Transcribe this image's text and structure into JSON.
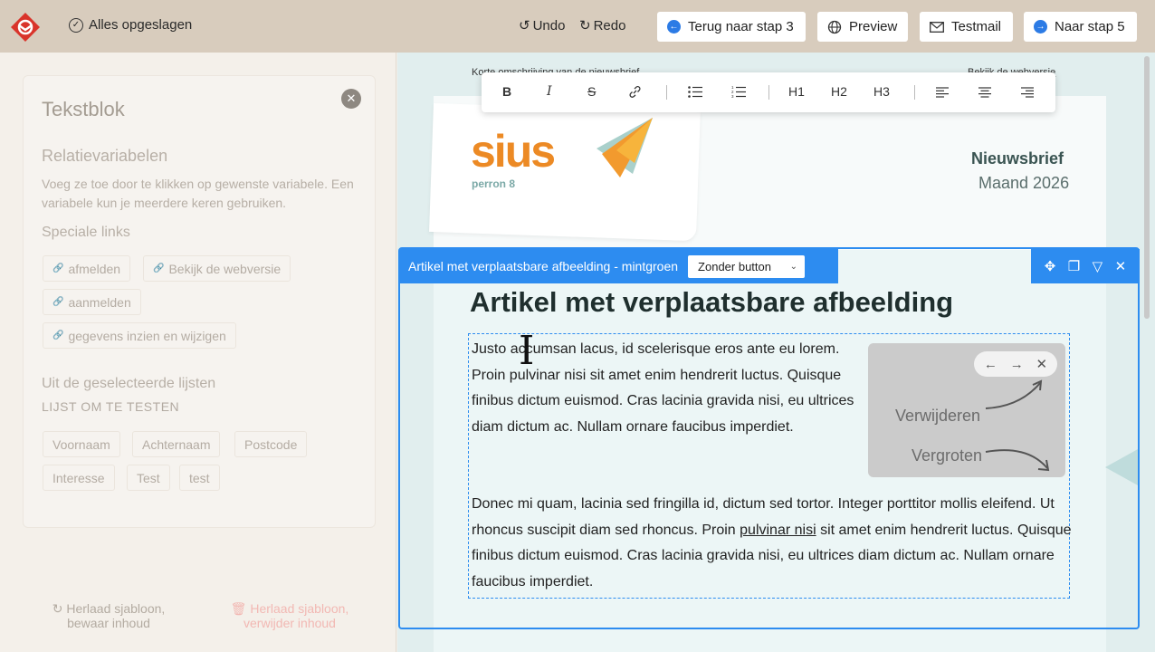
{
  "topbar": {
    "saved_label": "Alles opgeslagen",
    "undo_label": "Undo",
    "redo_label": "Redo",
    "back_label": "Terug naar stap 3",
    "preview_label": "Preview",
    "testmail_label": "Testmail",
    "next_label": "Naar stap 5"
  },
  "panel": {
    "title": "Tekstblok",
    "relation_title": "Relatievariabelen",
    "relation_desc": "Voeg ze toe door te klikken op gewenste variabele. Een variabele kun je meerdere keren gebruiken.",
    "special_title": "Speciale links",
    "special_links": [
      "afmelden",
      "Bekijk de webversie",
      "aanmelden",
      "gegevens inzien en wijzigen"
    ],
    "lists_title": "Uit de geselecteerde lijsten",
    "list_name": "LIJST OM TE TESTEN",
    "fields": [
      "Voornaam",
      "Achternaam",
      "Postcode",
      "Interesse",
      "Test",
      "test"
    ],
    "reload_keep": "Herlaad sjabloon, bewaar inhoud",
    "reload_delete": "Herlaad sjabloon, verwijder inhoud"
  },
  "email": {
    "top_left": "Korte omschrijving van de nieuwsbrief",
    "top_right": "Bekijk de webversie",
    "brand": "sius",
    "brand_sub": "perron 8",
    "newsletter": "Nieuwsbrief",
    "month": "Maand 2026",
    "block_title": "Artikel met verplaatsbare afbeelding - mintgroen",
    "button_select": "Zonder button",
    "article_title": "Artikel met verplaatsbare afbeelding",
    "para1": "Justo accumsan lacus, id scelerisque eros ante eu lorem. Proin pulvinar nisi sit amet enim hendrerit luctus. Quisque finibus dictum euismod. Cras lacinia gravida nisi, eu ultrices diam dictum ac. Nullam ornare faucibus imperdiet.",
    "para2_before": "Donec mi quam, lacinia sed fringilla id, dictum sed tortor. Integer porttitor mollis eleifend. Ut rhoncus suscipit diam sed rhoncus. Proin ",
    "para2_link": "pulvinar nisi",
    "para2_after": " sit amet enim hendrerit luctus. Quisque finibus dictum euismod. Cras lacinia gravida nisi, eu ultrices diam dictum ac. Nullam ornare faucibus imperdiet.",
    "img_remove": "Verwijderen",
    "img_enlarge": "Vergroten"
  },
  "toolbar": {
    "bold": "B",
    "italic": "I",
    "strike": "S",
    "h1": "H1",
    "h2": "H2",
    "h3": "H3"
  },
  "colors": {
    "accent": "#2d8cf0",
    "brand_orange": "#ec8a25",
    "topbar": "#d8ccbd"
  }
}
